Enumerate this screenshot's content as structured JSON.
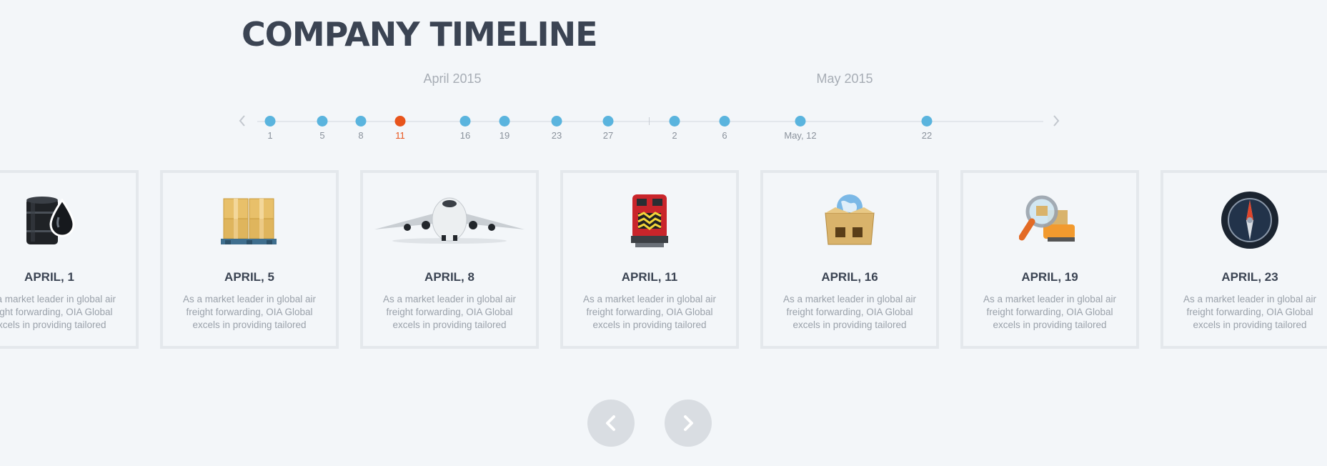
{
  "page": {
    "title": "COMPANY TIMELINE"
  },
  "timeline": {
    "months": [
      "April 2015",
      "May 2015"
    ],
    "dots": [
      {
        "label": "1",
        "active": false
      },
      {
        "label": "5",
        "active": false
      },
      {
        "label": "8",
        "active": false
      },
      {
        "label": "11",
        "active": true
      },
      {
        "label": "16",
        "active": false
      },
      {
        "label": "19",
        "active": false
      },
      {
        "label": "23",
        "active": false
      },
      {
        "label": "27",
        "active": false
      },
      {
        "label": "2",
        "active": false
      },
      {
        "label": "6",
        "active": false
      },
      {
        "label": "May, 12",
        "active": false
      },
      {
        "label": "22",
        "active": false
      }
    ],
    "prev_icon": "chevron-left-icon",
    "next_icon": "chevron-right-icon",
    "active_color": "#e8541c",
    "dot_color": "#5ab4de"
  },
  "cards": [
    {
      "date": "APRIL, 1",
      "text": "As a market leader in global air freight forwarding, OIA Global excels in providing tailored",
      "icon": "oil-barrel-icon"
    },
    {
      "date": "APRIL, 5",
      "text": "As a market leader in global air freight forwarding, OIA Global excels in providing tailored",
      "icon": "pallet-boxes-icon"
    },
    {
      "date": "APRIL, 8",
      "text": "As a market leader in global air freight forwarding, OIA Global excels in providing tailored",
      "icon": "airplane-icon"
    },
    {
      "date": "APRIL, 11",
      "text": "As a market leader in global air freight forwarding, OIA Global excels in providing tailored",
      "icon": "locomotive-icon"
    },
    {
      "date": "APRIL, 16",
      "text": "As a market leader in global air freight forwarding, OIA Global excels in providing tailored",
      "icon": "globe-box-icon"
    },
    {
      "date": "APRIL, 19",
      "text": "As a market leader in global air freight forwarding, OIA Global excels in providing tailored",
      "icon": "magnifier-truck-icon"
    },
    {
      "date": "APRIL, 23",
      "text": "As a market leader in global air freight forwarding, OIA Global excels in providing tailored",
      "icon": "compass-icon"
    }
  ],
  "carousel": {
    "prev_icon": "chevron-left-icon",
    "next_icon": "chevron-right-icon"
  }
}
